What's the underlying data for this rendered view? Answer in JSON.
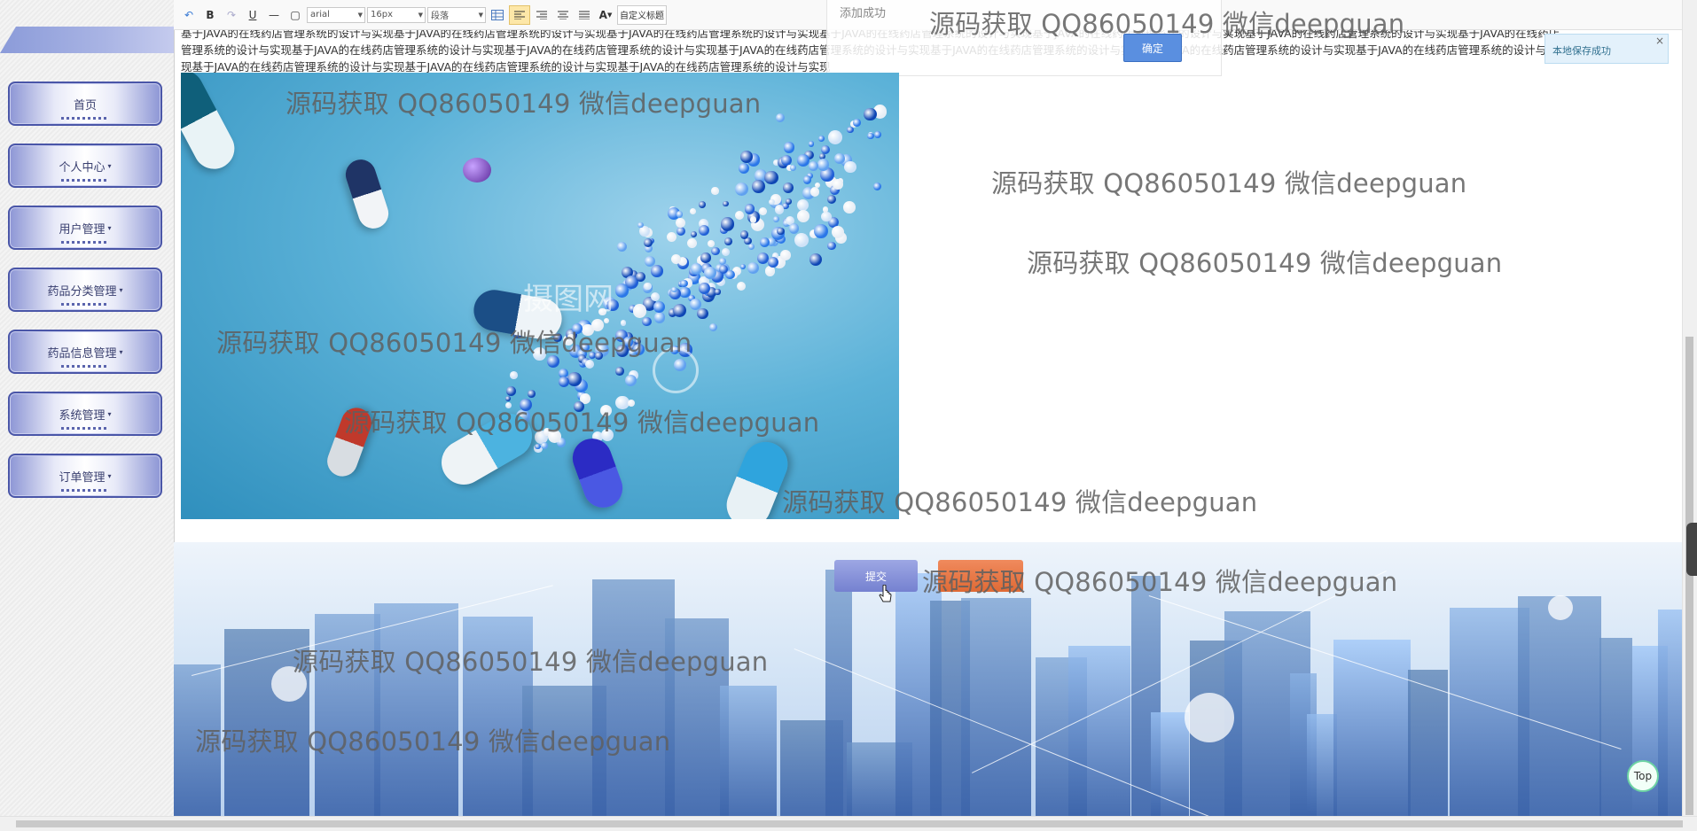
{
  "sidebar": {
    "items": [
      {
        "label": "首页",
        "has_caret": false
      },
      {
        "label": "个人中心",
        "has_caret": true
      },
      {
        "label": "用户管理",
        "has_caret": true
      },
      {
        "label": "药品分类管理",
        "has_caret": true
      },
      {
        "label": "药品信息管理",
        "has_caret": true
      },
      {
        "label": "系统管理",
        "has_caret": true
      },
      {
        "label": "订单管理",
        "has_caret": true
      }
    ],
    "caret": "▾"
  },
  "toolbar": {
    "undo": "↶",
    "bold": "B",
    "redo": "↷",
    "underline": "U",
    "hr": "—",
    "page": "▢",
    "font_family": "arial",
    "font_size": "16px",
    "paragraph": "段落",
    "font_color": "A",
    "custom_title": "自定义标题"
  },
  "editor": {
    "text": "基于JAVA的在线药店管理系统的设计与实现基于JAVA的在线药店管理系统的设计与实现基于JAVA的在线药店管理系统的设计与实现基于JAVA的在线药店管理系统的设计与实现基于JAVA的在线药店管理系统的设计与实现基于JAVA的在线药店管理系统的设计与实现基于JAVA的在线药店管理系统的设计与实现基于JAVA的在线药店管理系统的设计与实现基于JAVA的在线药店管理系统的设计与实现基于JAVA的在线药店管理系统的设计与实现基于JAVA的在线药店管理系统的设计与实现基于JAVA的在线药店管理系统的设计与实现基于JAVA的在线药店管理系统的设计与实现基于JAVA的在线药店管理系统的设计与实现基于JAVA的在线药店管理系统的设计与实现基于JAVA的在线药店管理系统的设计与实现"
  },
  "toasts": {
    "added": "添加成功",
    "added_button": "确定",
    "saved": "本地保存成功",
    "close": "×"
  },
  "stock_logo": "摄图网",
  "buttons": {
    "submit": "提交",
    "top": "Top"
  },
  "watermark": "源码获取 QQ86050149 微信deepguan"
}
